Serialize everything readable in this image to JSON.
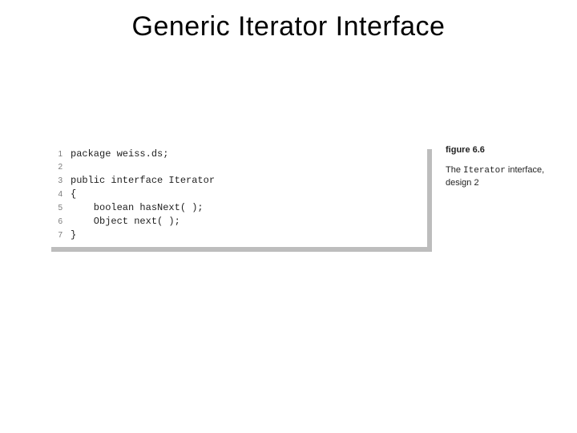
{
  "title": "Generic Iterator Interface",
  "figure": {
    "label": "figure 6.6",
    "caption_prefix": "The ",
    "caption_code": "Iterator",
    "caption_suffix": " interface, design 2"
  },
  "code": {
    "lines": [
      {
        "n": "1",
        "t": "package weiss.ds;"
      },
      {
        "n": "2",
        "t": ""
      },
      {
        "n": "3",
        "t": "public interface Iterator"
      },
      {
        "n": "4",
        "t": "{"
      },
      {
        "n": "5",
        "t": "    boolean hasNext( );"
      },
      {
        "n": "6",
        "t": "    Object next( );"
      },
      {
        "n": "7",
        "t": "}"
      }
    ]
  }
}
